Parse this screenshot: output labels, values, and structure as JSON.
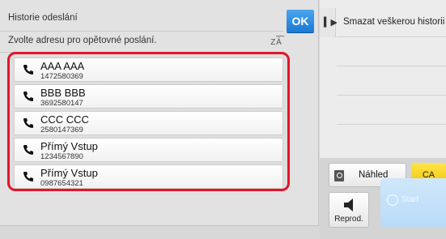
{
  "dialog": {
    "title": "Historie odeslání",
    "ok_label": "OK",
    "subtitle": "Zvolte adresu pro opětovné poslání.",
    "sort_icon_text": "Ā"
  },
  "history": [
    {
      "name": "AAA AAA",
      "number": "1472580369"
    },
    {
      "name": "BBB BBB",
      "number": "3692580147"
    },
    {
      "name": "CCC CCC",
      "number": "2580147369"
    },
    {
      "name": "Přímý Vstup",
      "number": "1234567890"
    },
    {
      "name": "Přímý Vstup",
      "number": "0987654321"
    }
  ],
  "side_panel": {
    "menu_items": [
      "Smazat veškerou historii",
      "",
      "",
      "",
      ""
    ],
    "preview_label": "Náhled",
    "ca_label": "CA",
    "playback_label": "Reprod.",
    "start_label": "Start"
  },
  "colors": {
    "ok_blue": "#1b79d3",
    "highlight_red": "#e0162b",
    "ca_yellow": "#f0c400",
    "start_blue": "#b9dbf8"
  }
}
